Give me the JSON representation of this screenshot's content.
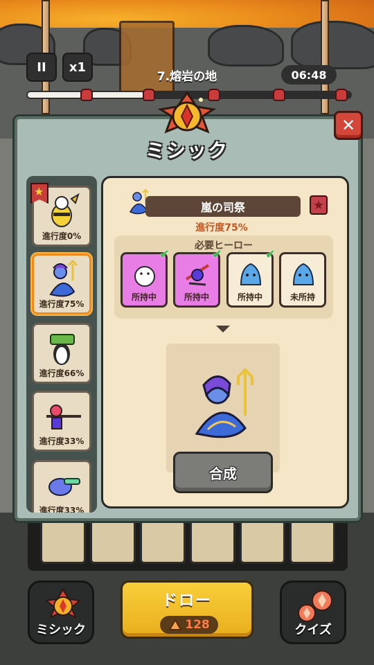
{
  "hud": {
    "pause_label": "II",
    "speed_label": "x1",
    "stage_title": "7.熔岩の地",
    "timer": "06:48",
    "wave_progress": 0.36
  },
  "modal": {
    "title": "ミシック",
    "close_label": "✕",
    "hero_list": [
      {
        "progress": "進行度0%",
        "icon": "bee-warrior-hero"
      },
      {
        "progress": "進行度75%",
        "icon": "sea-priest-hero",
        "selected": true
      },
      {
        "progress": "進行度66%",
        "icon": "bazooka-penguin-hero"
      },
      {
        "progress": "進行度33%",
        "icon": "sniper-hero"
      },
      {
        "progress": "進行度33%",
        "icon": "shark-gunner-hero"
      }
    ],
    "detail": {
      "name": "嵐の司祭",
      "progress": "進行度75%",
      "required_title": "必要ヒーロー",
      "required": [
        {
          "label": "所持中",
          "owned": true,
          "icon": "yeti-hero"
        },
        {
          "label": "所持中",
          "owned": true,
          "icon": "crossbow-hero"
        },
        {
          "label": "所持中",
          "owned": false,
          "checked": true,
          "icon": "slime-hero"
        },
        {
          "label": "未所持",
          "owned": false,
          "checked": false,
          "icon": "slime-hero"
        }
      ],
      "combine_label": "合成"
    }
  },
  "bottom_bar": {
    "mythic_label": "ミシック",
    "draw_label": "ドロー",
    "draw_cost": "128",
    "quiz_label": "クイズ"
  },
  "colors": {
    "accent_orange": "#f08a1a",
    "owned_pink": "#e97de6",
    "progress_orange": "#c9531d",
    "close_red": "#d3473a",
    "draw_yellow": "#f7cf3a"
  }
}
